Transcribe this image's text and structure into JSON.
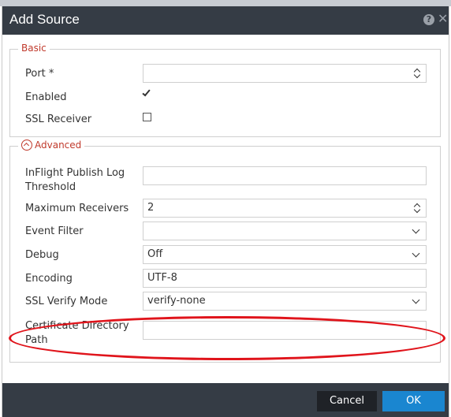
{
  "dialog": {
    "title": "Add Source"
  },
  "basic": {
    "legend": "Basic",
    "port": {
      "label": "Port *",
      "value": ""
    },
    "enabled": {
      "label": "Enabled",
      "checked": true
    },
    "ssl_receiver": {
      "label": "SSL Receiver",
      "checked": false
    }
  },
  "advanced": {
    "legend": "Advanced",
    "inflight_threshold": {
      "label": "InFlight Publish Log Threshold",
      "value": ""
    },
    "max_receivers": {
      "label": "Maximum Receivers",
      "value": "2"
    },
    "event_filter": {
      "label": "Event Filter",
      "value": ""
    },
    "debug": {
      "label": "Debug",
      "value": "Off"
    },
    "encoding": {
      "label": "Encoding",
      "value": "UTF-8"
    },
    "ssl_verify_mode": {
      "label": "SSL Verify Mode",
      "value": "verify-none"
    },
    "certificate_directory_path": {
      "label": "Certificate Directory Path",
      "value": ""
    }
  },
  "footer": {
    "cancel_label": "Cancel",
    "ok_label": "OK"
  },
  "colors": {
    "titlebar": "#353c45",
    "legend_text": "#c0392b",
    "highlight": "#e0141b",
    "ok_button": "#1a86d0"
  },
  "icons": {
    "help": "help-icon",
    "close": "close-icon",
    "collapse": "chevron-up-circle-icon",
    "spinner": "spinner-arrows-icon",
    "dropdown": "chevron-down-icon",
    "checkbox": "checkbox-icon"
  }
}
